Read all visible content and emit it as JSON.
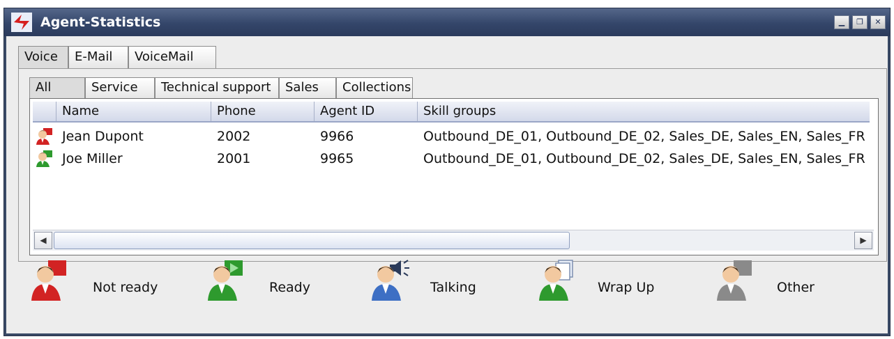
{
  "window": {
    "title": "Agent-Statistics"
  },
  "colors": {
    "titlebar": "#34466a",
    "not_ready": "#d22323",
    "ready": "#2e9a2e",
    "talking": "#3d6fc4",
    "wrap_up": "#2e9a2e",
    "other": "#8a8a8a"
  },
  "media_tabs": [
    {
      "label": "Voice",
      "active": true
    },
    {
      "label": "E-Mail",
      "active": false
    },
    {
      "label": "VoiceMail",
      "active": false
    }
  ],
  "group_tabs": [
    {
      "label": "All",
      "active": true
    },
    {
      "label": "Service",
      "active": false
    },
    {
      "label": "Technical support",
      "active": false
    },
    {
      "label": "Sales",
      "active": false
    },
    {
      "label": "Collections",
      "active": false
    }
  ],
  "table": {
    "columns": [
      "",
      "Name",
      "Phone",
      "Agent ID",
      "Skill groups"
    ],
    "rows": [
      {
        "status_icon": "not-ready-agent-icon",
        "name": "Jean Dupont",
        "phone": "2002",
        "agent_id": "9966",
        "skill_groups": "Outbound_DE_01, Outbound_DE_02, Sales_DE, Sales_EN, Sales_FR"
      },
      {
        "status_icon": "ready-agent-icon",
        "name": "Joe Miller",
        "phone": "2001",
        "agent_id": "9965",
        "skill_groups": "Outbound_DE_01, Outbound_DE_02, Sales_DE, Sales_EN, Sales_FR"
      }
    ]
  },
  "legend": [
    {
      "label": "Not ready",
      "icon": "not-ready-agent-icon"
    },
    {
      "label": "Ready",
      "icon": "ready-agent-icon"
    },
    {
      "label": "Talking",
      "icon": "talking-agent-icon"
    },
    {
      "label": "Wrap Up",
      "icon": "wrap-up-agent-icon"
    },
    {
      "label": "Other",
      "icon": "other-agent-icon"
    }
  ]
}
